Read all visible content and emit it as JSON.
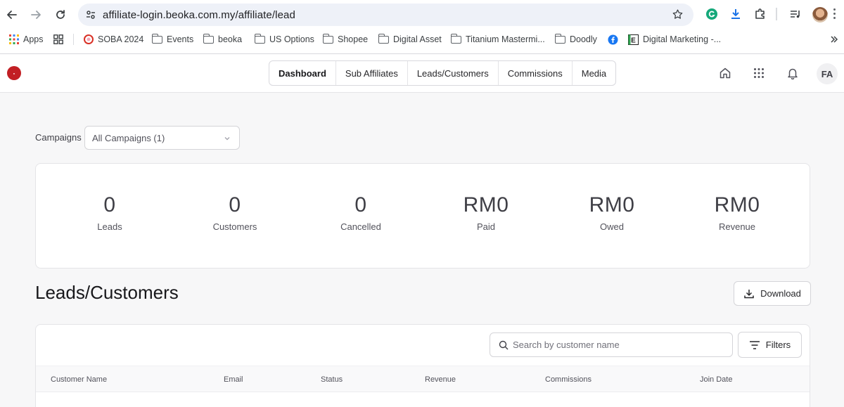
{
  "browser": {
    "url": "affiliate-login.beoka.com.my/affiliate/lead",
    "bookmarks": [
      {
        "label": "Apps",
        "icon": "apps-grid-icon"
      },
      {
        "label": "SOBA 2024",
        "icon": "soba-favicon-icon"
      },
      {
        "label": "Events",
        "icon": "folder-icon"
      },
      {
        "label": "beoka",
        "icon": "folder-icon"
      },
      {
        "label": "US Options",
        "icon": "folder-icon"
      },
      {
        "label": "Shopee",
        "icon": "folder-icon"
      },
      {
        "label": "Digital Asset",
        "icon": "folder-icon"
      },
      {
        "label": "Titanium Mastermi...",
        "icon": "folder-icon"
      },
      {
        "label": "Doodly",
        "icon": "folder-icon"
      },
      {
        "label": "Digital Marketing -...",
        "icon": "e-favicon-icon"
      }
    ]
  },
  "header": {
    "tabs": [
      {
        "label": "Dashboard",
        "active": true
      },
      {
        "label": "Sub Affiliates",
        "active": false
      },
      {
        "label": "Leads/Customers",
        "active": false
      },
      {
        "label": "Commissions",
        "active": false
      },
      {
        "label": "Media",
        "active": false
      }
    ],
    "user_initials": "FA",
    "logo_color": "#c21f24"
  },
  "campaigns": {
    "label": "Campaigns",
    "selected": "All Campaigns (1)"
  },
  "stats": [
    {
      "value": "0",
      "label": "Leads"
    },
    {
      "value": "0",
      "label": "Customers"
    },
    {
      "value": "0",
      "label": "Cancelled"
    },
    {
      "value": "RM0",
      "label": "Paid"
    },
    {
      "value": "RM0",
      "label": "Owed"
    },
    {
      "value": "RM0",
      "label": "Revenue"
    }
  ],
  "section": {
    "title": "Leads/Customers",
    "download_label": "Download"
  },
  "table": {
    "search_placeholder": "Search by customer name",
    "filters_label": "Filters",
    "columns": [
      "Customer Name",
      "Email",
      "Status",
      "Revenue",
      "Commissions",
      "Join Date"
    ]
  }
}
